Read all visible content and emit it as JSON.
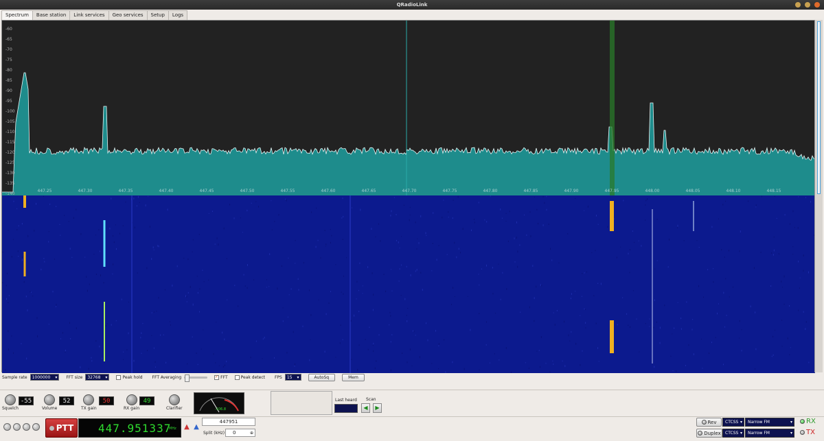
{
  "window": {
    "title": "QRadioLink"
  },
  "tabs": [
    "Spectrum",
    "Base station",
    "Link services",
    "Geo services",
    "Setup",
    "Logs"
  ],
  "spectrum": {
    "db_ticks": [
      "-60",
      "-65",
      "-70",
      "-75",
      "-80",
      "-85",
      "-90",
      "-95",
      "-100",
      "-105",
      "-110",
      "-115",
      "-120",
      "-125",
      "-130",
      "-135",
      "-140"
    ],
    "freq_ticks": [
      "447.25",
      "447.30",
      "447.35",
      "447.40",
      "447.45",
      "447.50",
      "447.55",
      "447.60",
      "447.65",
      "447.70",
      "447.75",
      "447.80",
      "447.85",
      "447.90",
      "447.95",
      "448.00",
      "448.05",
      "448.10",
      "448.15"
    ],
    "colors": {
      "plot_bg": "#222222",
      "fill": "#1e8c8c",
      "trace": "#e8f4f4",
      "waterfall": "#0c1a8e",
      "marker": "#2a7a2a"
    }
  },
  "controls": {
    "sample_rate_label": "Sample rate",
    "sample_rate_value": "1000000",
    "fft_size_label": "FFT size",
    "fft_size_value": "32768",
    "peak_hold_label": "Peak hold",
    "fft_avg_label": "FFT Averaging",
    "fft_label": "FFT",
    "peak_detect_label": "Peak detect",
    "fps_label": "FPS",
    "fps_value": "15",
    "autosq_label": "AutoSq",
    "mem_label": "Mem"
  },
  "knobs": {
    "squelch": {
      "label": "Squelch",
      "value": "-55"
    },
    "volume": {
      "label": "Volume",
      "value": "52"
    },
    "tx_gain": {
      "label": "TX gain",
      "value": "50"
    },
    "rx_gain": {
      "label": "RX gain",
      "value": "49"
    },
    "clarifier": {
      "label": "Clarifier"
    }
  },
  "meter": {
    "reading": "-106.8"
  },
  "last_heard_label": "Last heard",
  "scan_label": "Scan",
  "bottom": {
    "ptt_label": "PTT",
    "frequency": "447.951337",
    "freq_unit": "MHz",
    "tune_value": "447951",
    "split_label": "Split (kHz)",
    "split_value": "0",
    "rev_label": "Rev",
    "duplex_label": "Duplex",
    "ctcss_label_1": "CTCSS",
    "ctcss_label_2": "CTCSS",
    "mode_1": "Narrow FM",
    "mode_2": "Narrow FM",
    "rx_label": "RX",
    "tx_label": "TX"
  }
}
